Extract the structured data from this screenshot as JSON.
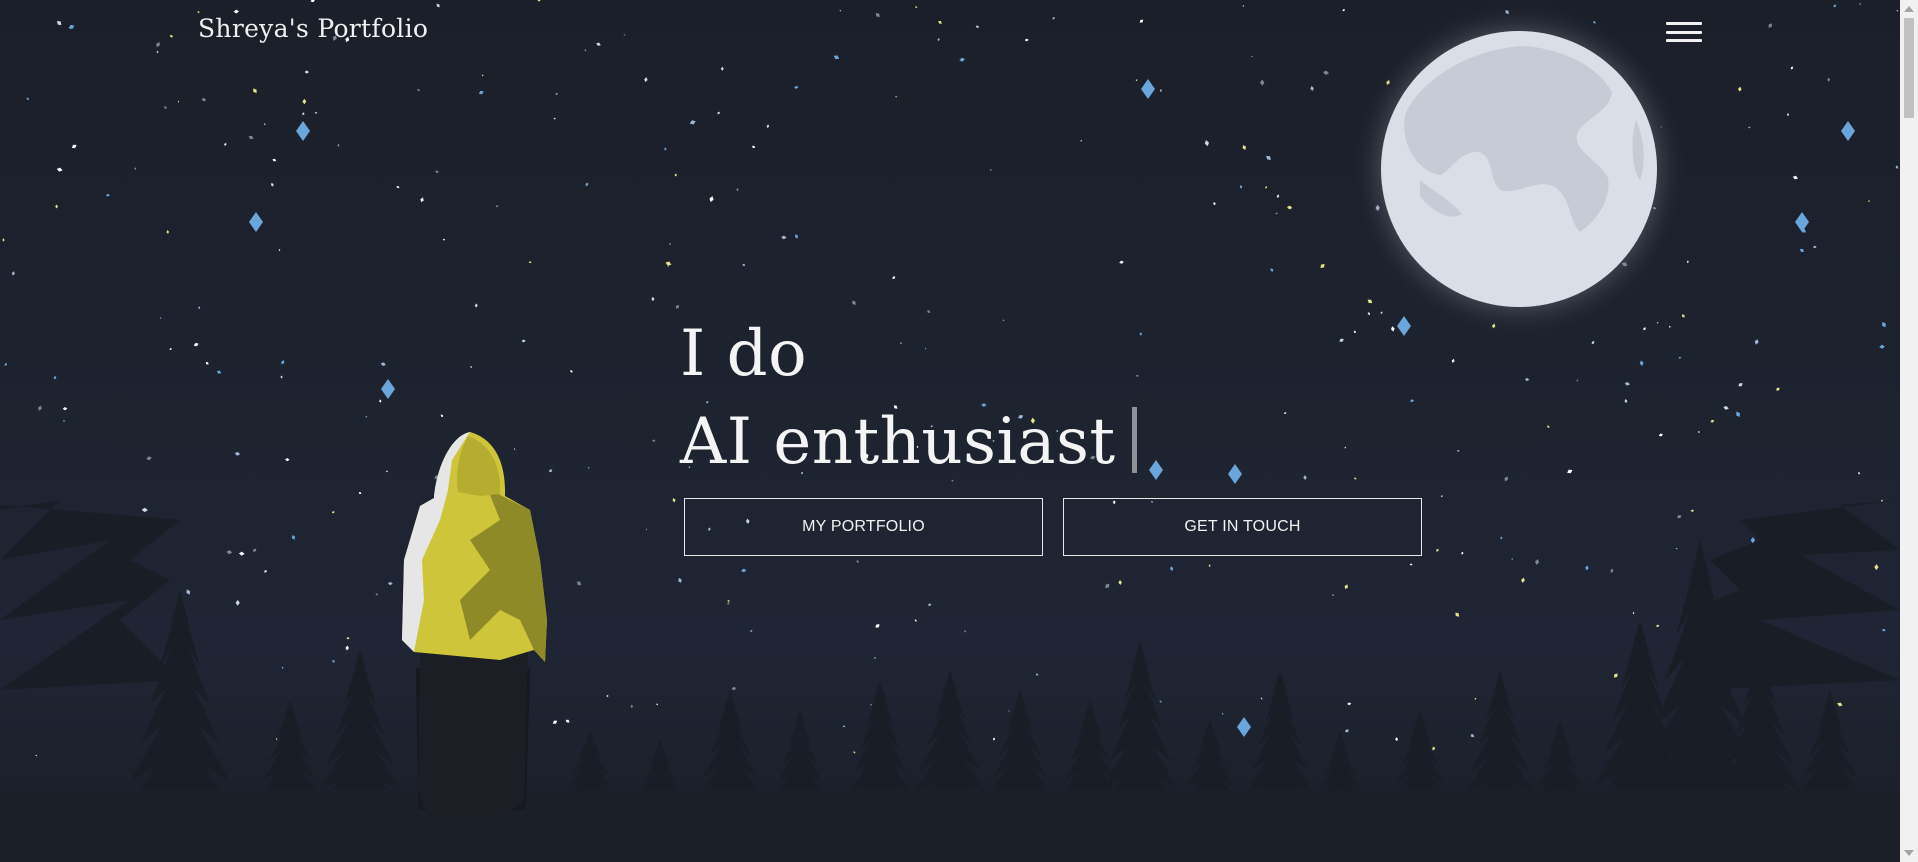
{
  "nav": {
    "brand": "Shreya's Portfolio",
    "menu_icon": "hamburger-menu-icon"
  },
  "hero": {
    "line1": "I do",
    "line2": "AI enthusiast"
  },
  "buttons": {
    "portfolio": "MY PORTFOLIO",
    "contact": "GET IN TOUCH"
  },
  "colors": {
    "sky_top": "#1b1f29",
    "sky_mid": "#1f2534",
    "moon": "#dadfe7",
    "moon_craters": "#c6ccd5",
    "jacket": "#cfc53a",
    "trees": "#191d26",
    "accent_star": "#6aa6dc"
  }
}
